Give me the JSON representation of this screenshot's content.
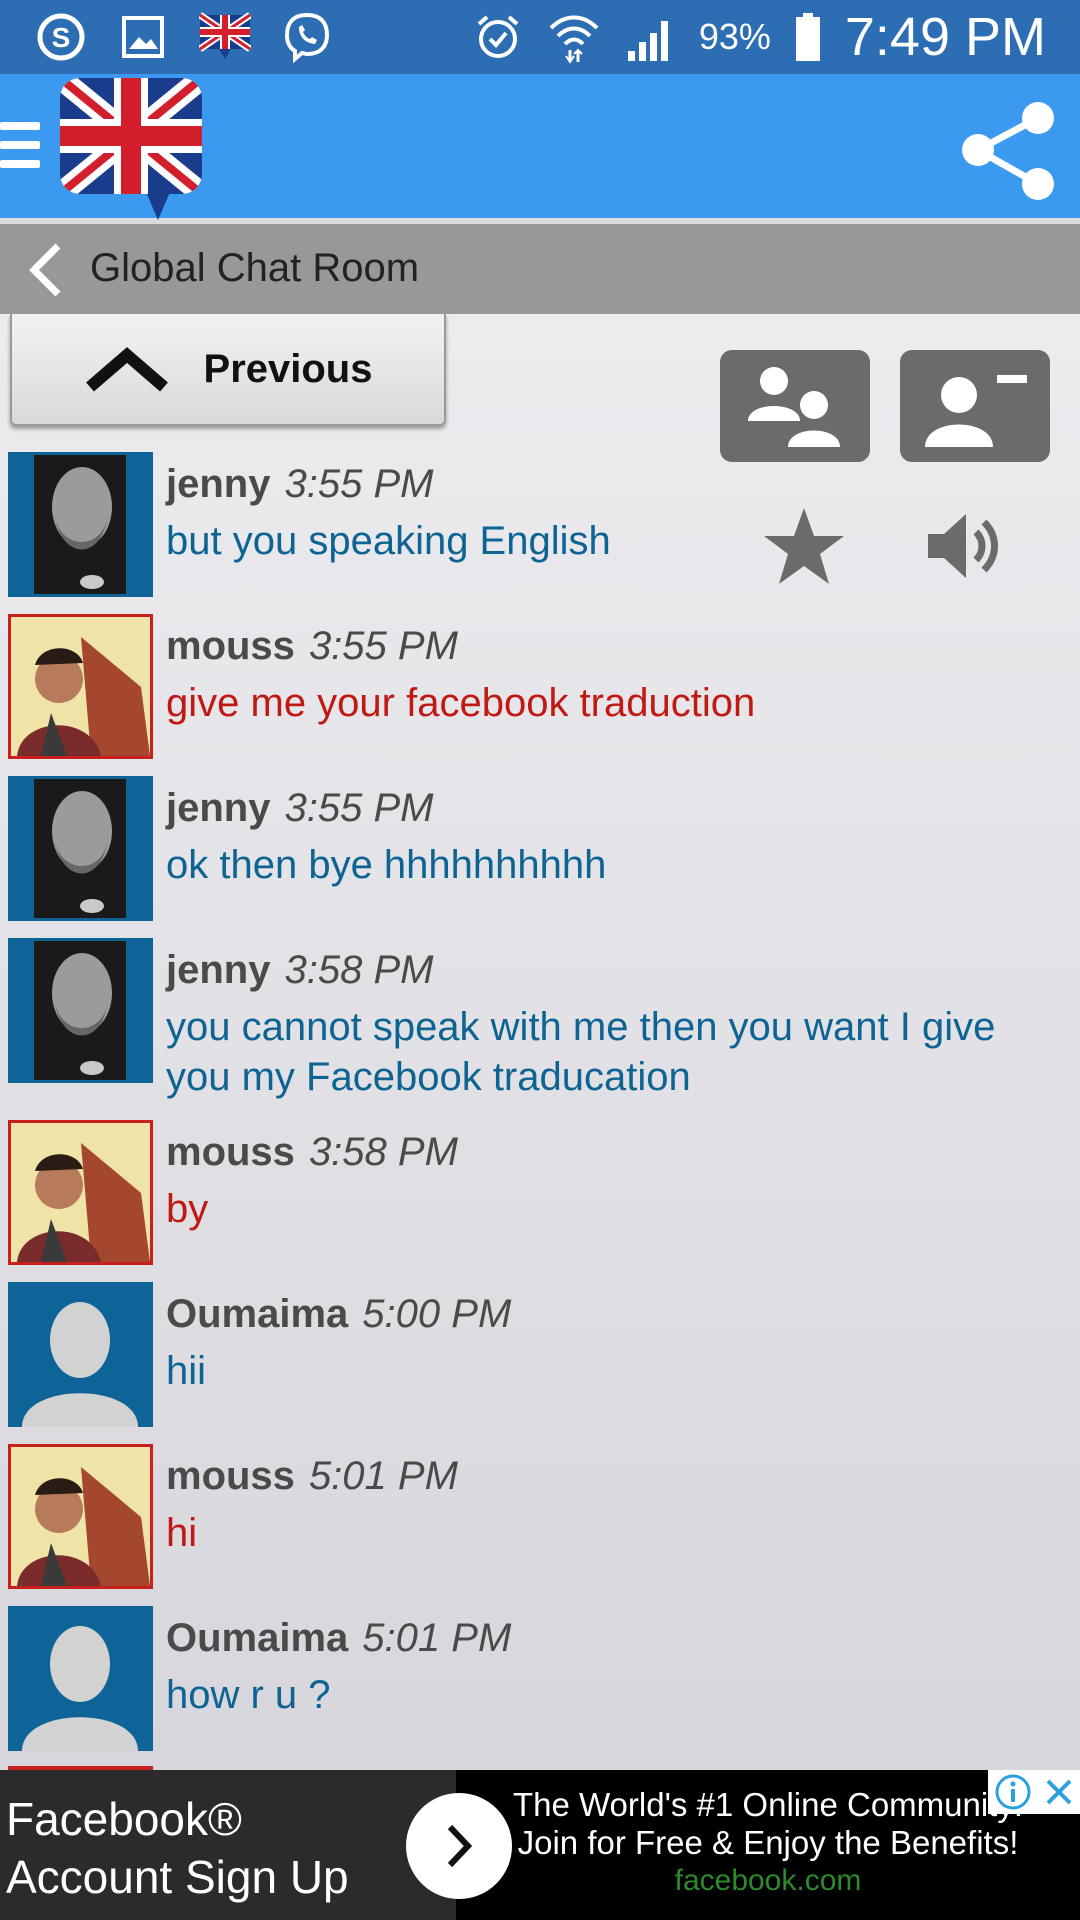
{
  "status_bar": {
    "battery": "93%",
    "time": "7:49 PM",
    "left_icons": [
      "skype-icon",
      "gallery-icon",
      "uk-flag-icon",
      "viber-icon"
    ],
    "right_icons": [
      "alarm-icon",
      "wifi-icon",
      "signal-icon",
      "battery-icon"
    ]
  },
  "app_bar": {
    "menu_icon": "hamburger-menu-icon",
    "logo": "uk-flag-chat-logo",
    "share_icon": "share-icon",
    "color": "#3b99f0"
  },
  "room": {
    "title": "Global Chat Room",
    "back_icon": "chevron-left-icon"
  },
  "toolbar": {
    "previous_label": "Previous",
    "buttons": [
      "users-icon",
      "remove-contact-icon",
      "star-icon",
      "speaker-icon"
    ]
  },
  "messages": [
    {
      "user": "jenny",
      "time": "3:55 PM",
      "text": "but you speaking English",
      "color": "#0d6493"
    },
    {
      "user": "mouss",
      "time": "3:55 PM",
      "text": "give me your facebook traduction",
      "color": "#c01913"
    },
    {
      "user": "jenny",
      "time": "3:55 PM",
      "text": "ok then bye hhhhhhhhhh",
      "color": "#0d6493"
    },
    {
      "user": "jenny",
      "time": "3:58 PM",
      "text": "you cannot speak with me then you want I give you my Facebook traducation",
      "color": "#0d6493"
    },
    {
      "user": "mouss",
      "time": "3:58 PM",
      "text": "by",
      "color": "#c01913"
    },
    {
      "user": "Oumaima",
      "time": "5:00 PM",
      "text": "hii",
      "color": "#0d6493"
    },
    {
      "user": "mouss",
      "time": "5:01 PM",
      "text": "hi",
      "color": "#c01913"
    },
    {
      "user": "Oumaima",
      "time": "5:01 PM",
      "text": "how r u ?",
      "color": "#0d6493"
    }
  ],
  "ad": {
    "left_line1": "Facebook®",
    "left_line2": "Account Sign Up",
    "right_line1": "The World's #1 Online Community!",
    "right_line2": "Join for Free & Enjoy the Benefits!",
    "right_line3": "facebook.com",
    "info_icon": "info-icon",
    "close_icon": "close-icon"
  }
}
